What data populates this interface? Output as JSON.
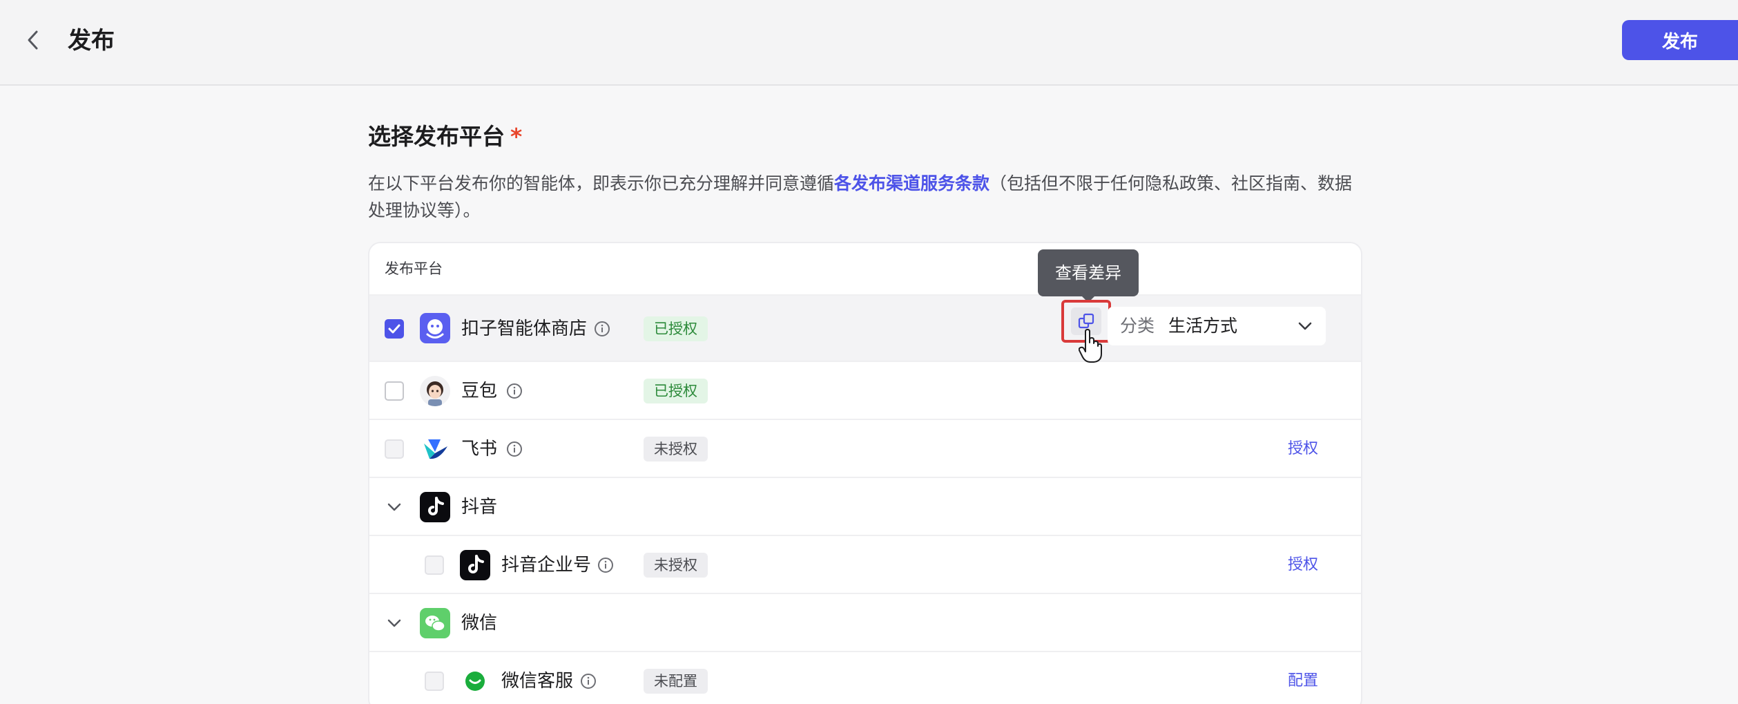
{
  "header": {
    "title": "发布",
    "publish_label": "发布"
  },
  "section": {
    "title": "选择发布平台",
    "required_mark": "*",
    "desc_before": "在以下平台发布你的智能体，即表示你已充分理解并同意遵循",
    "desc_link": "各发布渠道服务条款",
    "desc_after": "（包括但不限于任何隐私政策、社区指南、数据处理协议等）。"
  },
  "table": {
    "column_header": "发布平台",
    "rows": [
      {
        "name": "扣子智能体商店",
        "status": "已授权",
        "checked": true
      },
      {
        "name": "豆包",
        "status": "已授权",
        "checked": false
      },
      {
        "name": "飞书",
        "status": "未授权",
        "action": "授权",
        "checked": false
      },
      {
        "name": "抖音",
        "group": true
      },
      {
        "name": "抖音企业号",
        "status": "未授权",
        "action": "授权",
        "checked": false
      },
      {
        "name": "微信",
        "group": true
      },
      {
        "name": "微信客服",
        "status": "未配置",
        "action": "配置",
        "checked": false
      }
    ]
  },
  "tooltip": {
    "text": "查看差异"
  },
  "category": {
    "label": "分类",
    "value": "生活方式"
  },
  "colors": {
    "accent": "#4d53e8",
    "authorized_bg": "#e3f5e6",
    "authorized_text": "#2c8a3a",
    "highlight_border": "#d93a3a"
  }
}
